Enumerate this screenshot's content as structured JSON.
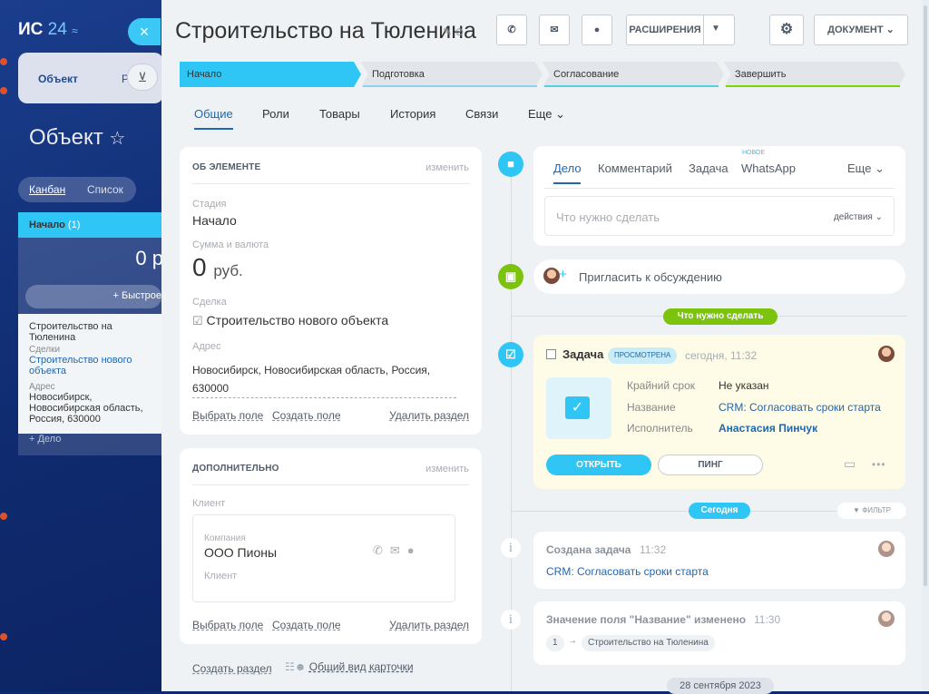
{
  "background": {
    "logo_main": "ИС",
    "logo_num": "24",
    "logo_sym": "≈",
    "close_icon": "×",
    "tab_object": "Объект",
    "tab_second": "Р",
    "page_title": "Объект",
    "star": "☆",
    "view_kanban": "Канбан",
    "view_list": "Список",
    "column_name": "Начало",
    "column_count": "(1)",
    "column_sum": "0 р",
    "quick_add": "+ Быстрое",
    "card_title": "Строительство на Тюленина",
    "card_deal_label": "Сделки",
    "card_deal_value": "Строительство нового объекта",
    "card_addr_label": "Адрес",
    "card_addr_value": "Новосибирск, Новосибирская область, Россия, 630000",
    "card_add_case": "+ Дело"
  },
  "header": {
    "title": "Строительство на Тюленина",
    "extensions_label": "РАСШИРЕНИЯ",
    "document_label": "ДОКУМЕНТ"
  },
  "stages": [
    "Начало",
    "Подготовка",
    "Согласование",
    "Завершить"
  ],
  "tabs": [
    "Общие",
    "Роли",
    "Товары",
    "История",
    "Связи",
    "Еще"
  ],
  "about": {
    "title": "ОБ ЭЛЕМЕНТЕ",
    "change": "изменить",
    "stage_label": "Стадия",
    "stage_value": "Начало",
    "sum_label": "Сумма и валюта",
    "sum_value": "0",
    "sum_currency": "руб.",
    "deal_label": "Сделка",
    "deal_value": "Строительство нового объекта",
    "addr_label": "Адрес",
    "addr_line1": "Новосибирск, Новосибирская область, Россия,",
    "addr_line2": "630000",
    "choose_field": "Выбрать поле",
    "create_field": "Создать поле",
    "delete_section": "Удалить раздел"
  },
  "additional": {
    "title": "ДОПОЛНИТЕЛЬНО",
    "change": "изменить",
    "client_label": "Клиент",
    "company_label": "Компания",
    "company_value": "ООО Пионы",
    "client_sub": "Клиент",
    "choose_field": "Выбрать поле",
    "create_field": "Создать поле",
    "delete_section": "Удалить раздел"
  },
  "footer": {
    "create_section": "Создать раздел",
    "common_view": "Общий вид карточки"
  },
  "activity": {
    "tabs": [
      "Дело",
      "Комментарий",
      "Задача",
      "WhatsApp",
      "Еще"
    ],
    "new_badge": "НОВОЕ",
    "placeholder": "Что нужно сделать",
    "actions": "действия"
  },
  "invite": "Пригласить к обсуждению",
  "todo_divider": "Что нужно сделать",
  "task": {
    "label": "Задача",
    "status": "ПРОСМОТРЕНА",
    "time": "сегодня, 11:32",
    "deadline_label": "Крайний срок",
    "deadline_value": "Не указан",
    "name_label": "Название",
    "name_value": "CRM: Согласовать сроки старта",
    "assignee_label": "Исполнитель",
    "assignee_value": "Анастасия Пинчук",
    "open_button": "ОТКРЫТЬ",
    "ping_button": "ПИНГ"
  },
  "today_divider": "Сегодня",
  "filter_label": "ФИЛЬТР",
  "event1": {
    "title": "Создана задача",
    "time": "11:32",
    "link": "CRM: Согласовать сроки старта"
  },
  "event2": {
    "title": "Значение поля \"Название\" изменено",
    "time": "11:30",
    "from_value": "1",
    "to_value": "Строительство на Тюленина"
  },
  "date_divider": "28 сентября 2023",
  "colors": {
    "accent": "#2fc6f6",
    "green": "#7bc30c",
    "link": "#2067b0"
  }
}
